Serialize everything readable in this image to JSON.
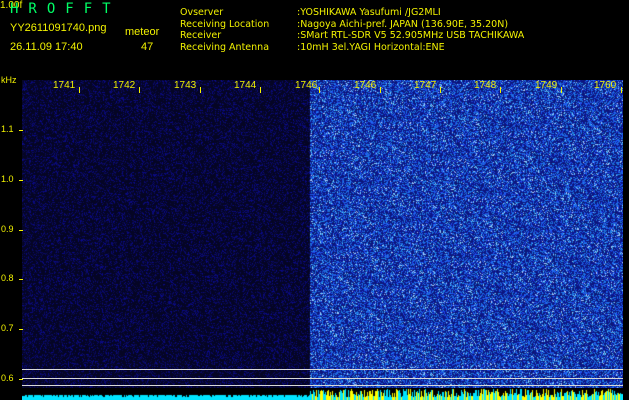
{
  "header": {
    "app_title": "HROFFT",
    "version": "1.00f",
    "file_name": "YY2611091740.png",
    "datetime": "26.11.09 17:40",
    "meteor_label": "meteor",
    "meteor_count": "47"
  },
  "info": [
    {
      "key": "Ovserver",
      "value": ":YOSHIKAWA Yasufumi /JG2MLI"
    },
    {
      "key": "Receiving Location",
      "value": ":Nagoya Aichi-pref. JAPAN (136.90E, 35.20N)"
    },
    {
      "key": "Receiver",
      "value": ":SMart RTL-SDR V5 52.905MHz USB TACHIKAWA"
    },
    {
      "key": "Receiving Antenna",
      "value": ":10mH 3el.YAGI Horizontal:ENE"
    }
  ],
  "axes": {
    "y_unit": "kHz",
    "y_ticks": [
      "1.1",
      "1.0",
      "0.9",
      "0.8",
      "0.7",
      "0.6"
    ],
    "x_ticks": [
      "1741",
      "1742",
      "1743",
      "1744",
      "1746",
      "1746",
      "1747",
      "1748",
      "1749",
      "1760"
    ]
  },
  "colors": {
    "label_yellow": "#f2f200",
    "title_green": "#00ff66",
    "noise_dark": "#06062a",
    "noise_bright": "#0d1a78",
    "strip_cyan": "#00e5ff",
    "strip_yellow": "#ffff00"
  }
}
